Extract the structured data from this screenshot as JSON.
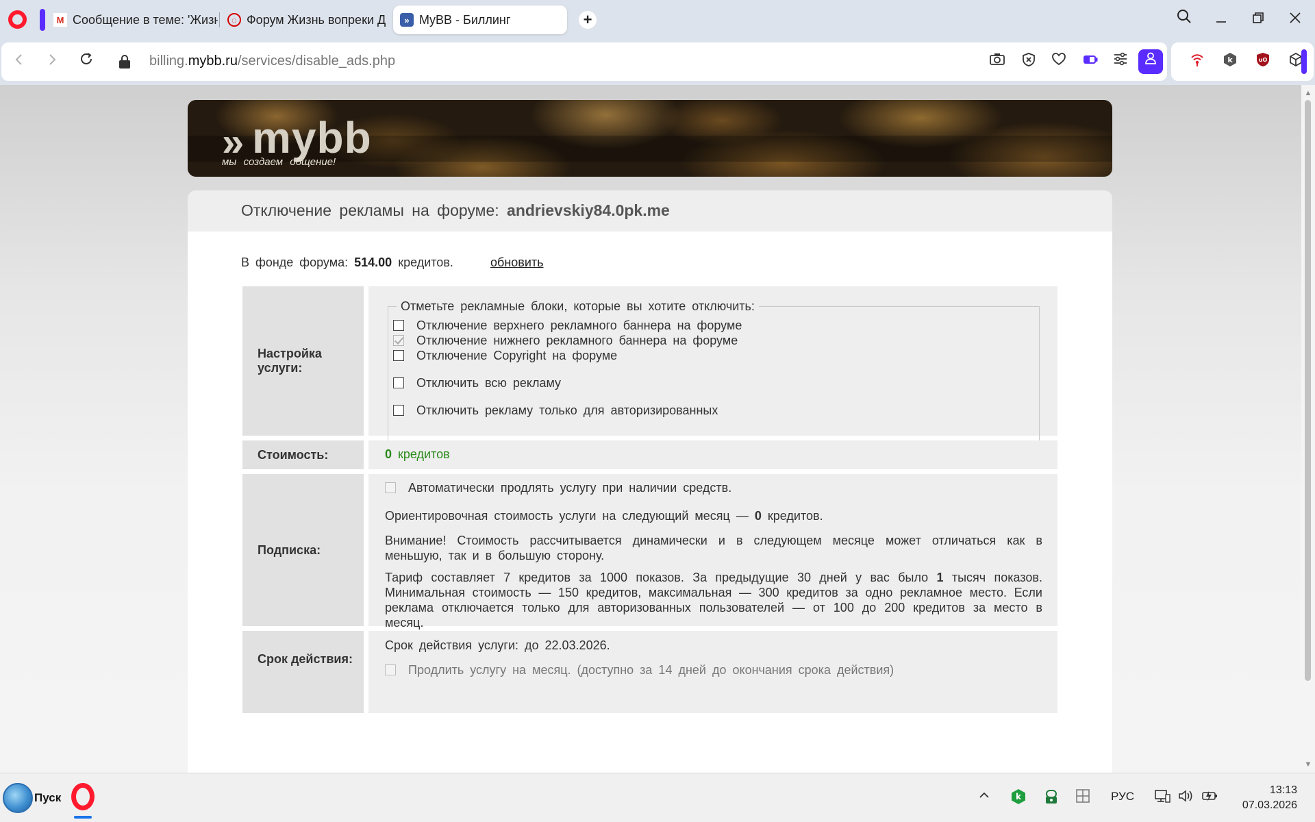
{
  "browser": {
    "tabs": [
      {
        "label": "Сообщение в теме: 'Жизн"
      },
      {
        "label": "Форум Жизнь вопреки Д"
      },
      {
        "label": "MyBB - Биллинг"
      }
    ],
    "new_tab": "+",
    "url": {
      "domain_sub": "billing.",
      "domain": "mybb.ru",
      "path": "/services/disable_ads.php"
    }
  },
  "page": {
    "banner": {
      "logo_chevrons": "»",
      "logo_word": "mybb",
      "slogan": "мы создаем общение!"
    },
    "title_prefix": "Отключение рекламы на форуме:",
    "title_forum": "andrievskiy84.0pk.me",
    "fund": {
      "prefix": "В фонде форума:",
      "amount": "514.00",
      "suffix": "кредитов.",
      "refresh": "обновить"
    },
    "settings": {
      "label": "Настройка услуги:",
      "legend": "Отметьте рекламные блоки, которые вы хотите отключить:",
      "options": [
        {
          "label": "Отключение верхнего рекламного баннера на форуме",
          "state": "unchecked"
        },
        {
          "label": "Отключение нижнего рекламного баннера на форуме",
          "state": "checked-disabled"
        },
        {
          "label": "Отключение Copyright на форуме",
          "state": "unchecked"
        },
        {
          "label": "Отключить всю рекламу",
          "state": "unchecked"
        },
        {
          "label": "Отключить рекламу только для авторизированных",
          "state": "unchecked"
        }
      ]
    },
    "cost": {
      "label": "Стоимость:",
      "value": "0",
      "unit": "кредитов"
    },
    "subscription": {
      "label": "Подписка:",
      "auto_renew": "Автоматически продлять услугу при наличии средств.",
      "estimate_prefix": "Ориентировочная стоимость услуги на следующий месяц —",
      "estimate_value": "0",
      "estimate_suffix": "кредитов.",
      "warning": "Внимание! Стоимость рассчитывается динамически и в следующем месяце может отличаться как в меньшую, так и в большую сторону.",
      "tariff_prefix": "Тариф составляет 7 кредитов за 1000 показов. За предыдущие 30 дней у вас было",
      "tariff_count": "1",
      "tariff_suffix": "тысяч показов. Минимальная стоимость — 150 кредитов, максимальная — 300 кредитов за одно рекламное место. Если реклама отключается только для авторизованных пользователей — от 100 до 200 кредитов за место в месяц."
    },
    "validity": {
      "label": "Срок действия:",
      "until": "Срок действия услуги: до 22.03.2026.",
      "extend": "Продлить услугу на месяц. (доступно за 14 дней до окончания срока действия)"
    }
  },
  "taskbar": {
    "start": "Пуск",
    "lang": "РУС",
    "time": "13:13",
    "date": "07.03.2026"
  },
  "colors": {
    "accent": "#5a2cff",
    "opera_red": "#ff1b2d",
    "cost_green": "#2a8a1a"
  }
}
